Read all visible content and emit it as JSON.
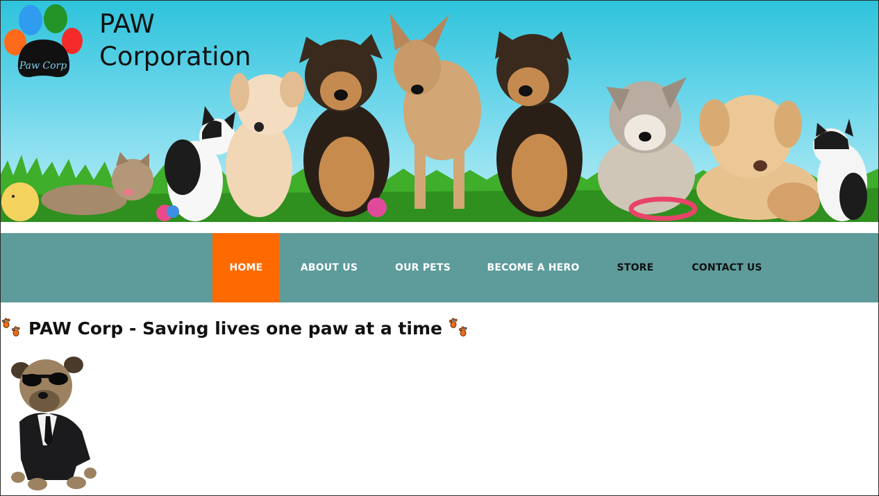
{
  "brand": {
    "logo_text": "Paw Corp",
    "title_line1": "PAW",
    "title_line2": "Corporation"
  },
  "nav": {
    "items": [
      {
        "label": "HOME",
        "active": true
      },
      {
        "label": "ABOUT US",
        "active": false
      },
      {
        "label": "OUR PETS",
        "active": false
      },
      {
        "label": "BECOME A HERO",
        "active": false
      },
      {
        "label": "STORE",
        "active": false
      },
      {
        "label": "CONTACT US",
        "active": false
      }
    ]
  },
  "main": {
    "headline": "PAW Corp - Saving lives one paw at a time",
    "headline_icon": "paw-prints-icon",
    "image": "dog-in-suit-image"
  },
  "colors": {
    "nav_background": "#5e9b9b",
    "nav_active": "#ff6a00",
    "sky": "#2ec3dc",
    "grass": "#3fae2a"
  }
}
